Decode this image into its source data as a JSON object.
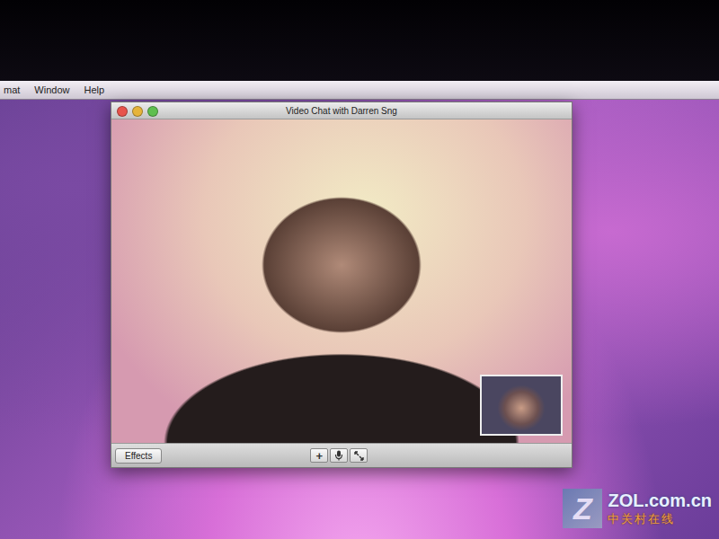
{
  "menu_bar": {
    "items": [
      "mat",
      "Window",
      "Help"
    ]
  },
  "window": {
    "title": "Video Chat with Darren Sng",
    "controls": [
      {
        "name": "close",
        "color": "#e8544c"
      },
      {
        "name": "minimize",
        "color": "#e6b43a"
      },
      {
        "name": "zoom",
        "color": "#5fbf4f"
      }
    ]
  },
  "video": {
    "self_preview": true
  },
  "toolbar": {
    "effects_button": "Effects",
    "buttons": [
      {
        "kind": "add",
        "label": "+"
      },
      {
        "kind": "mute",
        "label": ""
      },
      {
        "kind": "fullscreen",
        "label": ""
      }
    ]
  },
  "watermark": {
    "logo_letter": "Z",
    "brand": "ZOL.com.cn",
    "subtitle": "中关村在线"
  }
}
